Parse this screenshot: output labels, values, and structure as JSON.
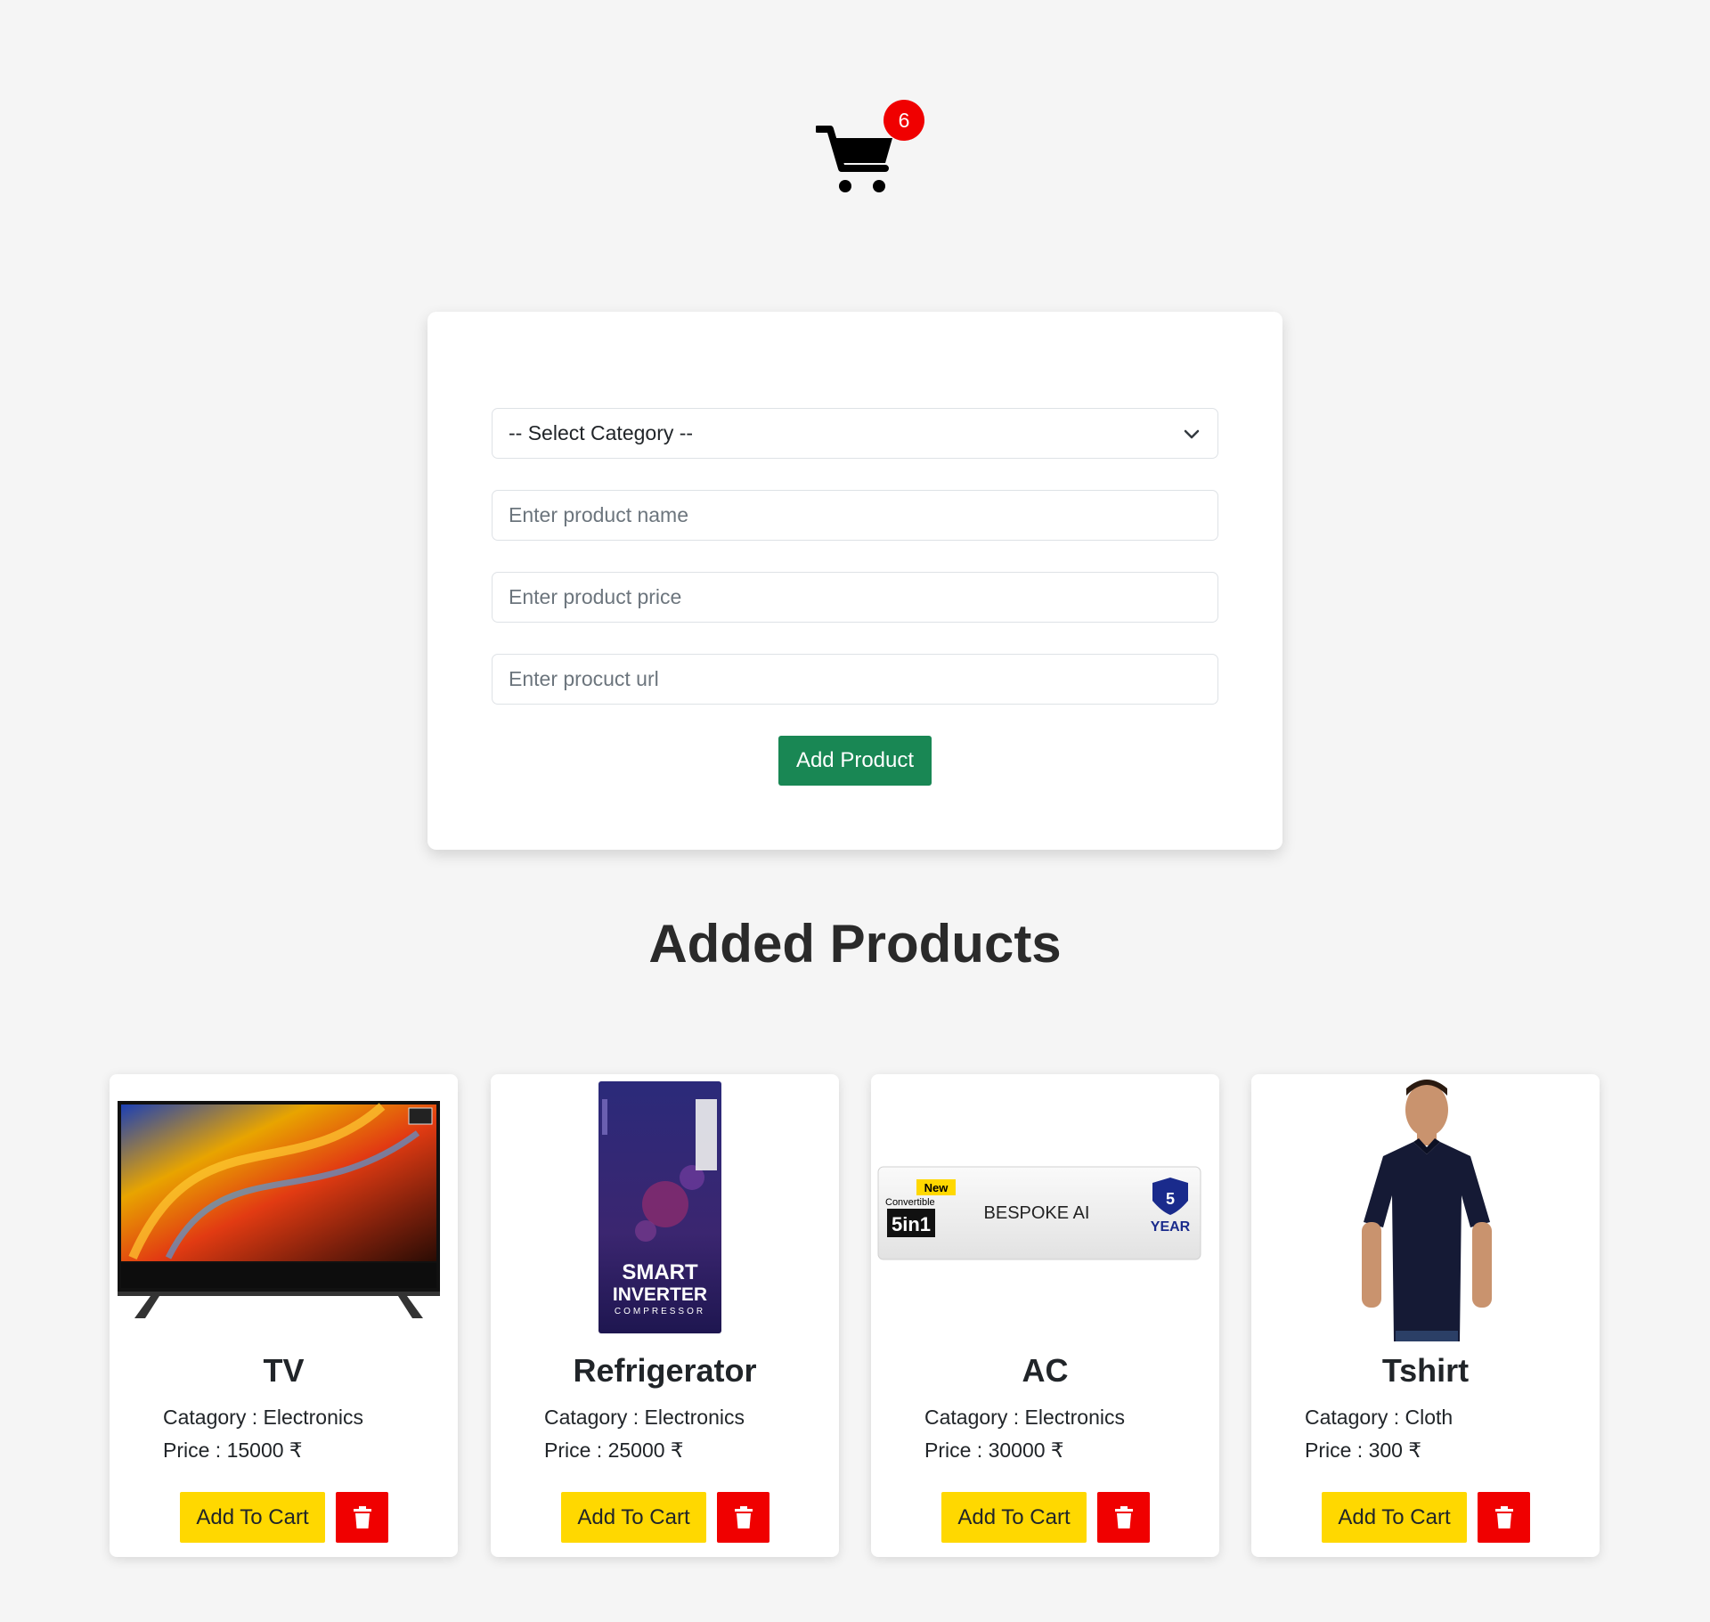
{
  "header": {
    "cart_count": "6"
  },
  "form": {
    "category_select": "-- Select Category --",
    "name_placeholder": "Enter product name",
    "price_placeholder": "Enter product price",
    "url_placeholder": "Enter procuct url",
    "submit_label": "Add Product"
  },
  "section_title": "Added Products",
  "products": [
    {
      "name": "TV",
      "category": "Catagory : Electronics",
      "price": "Price : 15000 ₹",
      "add_label": "Add To Cart"
    },
    {
      "name": "Refrigerator",
      "category": "Catagory : Electronics",
      "price": "Price : 25000 ₹",
      "add_label": "Add To Cart"
    },
    {
      "name": "AC",
      "category": "Catagory : Electronics",
      "price": "Price : 30000 ₹",
      "add_label": "Add To Cart"
    },
    {
      "name": "Tshirt",
      "category": "Catagory : Cloth",
      "price": "Price : 300 ₹",
      "add_label": "Add To Cart"
    }
  ],
  "colors": {
    "background": "#f5f5f5",
    "badge": "#f00000",
    "add_product_button": "#198754",
    "add_to_cart_button": "#ffd800",
    "delete_button": "#f00000"
  },
  "icons": {
    "cart": "shopping-cart-icon",
    "dropdown": "chevron-down-icon",
    "delete": "trash-icon"
  }
}
